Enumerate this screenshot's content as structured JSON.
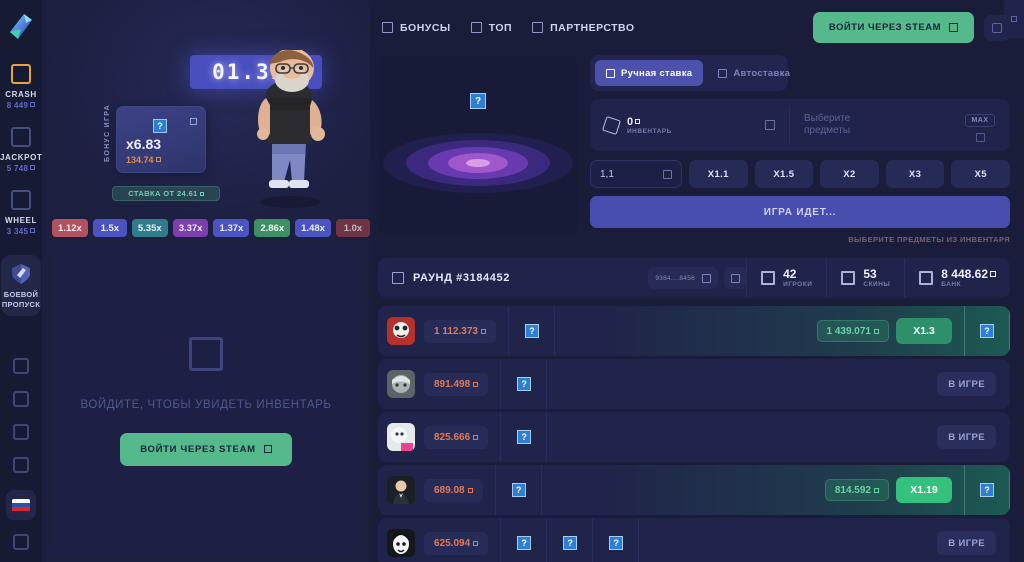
{
  "brand": {
    "logo_icon": "logo-arrow-icon",
    "accent_green": "#55b98c",
    "accent_purple": "#474ead"
  },
  "sidebar": {
    "games": [
      {
        "icon": "crash-icon",
        "title": "CRASH",
        "amount": "8 449"
      },
      {
        "icon": "jackpot-icon",
        "title": "JACKPOT",
        "amount": "5 748"
      },
      {
        "icon": "wheel-icon",
        "title": "WHEEL",
        "amount": "3 345"
      }
    ],
    "battle_pass": {
      "icon": "battle-pass-shield-icon",
      "line1": "БОЕВОЙ",
      "line2": "ПРОПУСК"
    },
    "mini_items": [
      "menu-icon-1",
      "menu-icon-2",
      "menu-icon-3",
      "menu-icon-4"
    ],
    "language": {
      "icon": "flag-ru-icon",
      "colors": [
        "#ffffff",
        "#2b50a8",
        "#d8262f"
      ]
    },
    "bottom_item": "settings-icon"
  },
  "game": {
    "counter": "01.31x",
    "bonus_label": "БОНУС ИГРА",
    "bonus_card": {
      "multiplier": "x6.83",
      "amount": "134.74",
      "item_icon": "crate-item-icon"
    },
    "bet_from": "СТАВКА ОТ 24.61",
    "character": "gaben-character",
    "history": [
      {
        "value": "1.12x",
        "color": "#b2525e"
      },
      {
        "value": "1.5x",
        "color": "#4a53c0"
      },
      {
        "value": "5.35x",
        "color": "#2f7d8b"
      },
      {
        "value": "3.37x",
        "color": "#7b3fad"
      },
      {
        "value": "1.37x",
        "color": "#4a53c0"
      },
      {
        "value": "2.86x",
        "color": "#3d8f66"
      },
      {
        "value": "1.48x",
        "color": "#4a53c0"
      },
      {
        "value": "1.0x",
        "color": "#8c3a44"
      }
    ]
  },
  "inventory": {
    "empty_icon": "empty-box-icon",
    "empty_text": "ВОЙДИТЕ, ЧТОБЫ УВИДЕТЬ ИНВЕНТАРЬ",
    "login_button": "ВОЙТИ ЧЕРЕЗ STEAM"
  },
  "header": {
    "nav": [
      {
        "icon": "gift-icon",
        "label": "БОНУСЫ"
      },
      {
        "icon": "trophy-icon",
        "label": "ТОП"
      },
      {
        "icon": "handshake-icon",
        "label": "ПАРТНЕРСТВО"
      }
    ],
    "login_button": "ВОЙТИ ЧЕРЕЗ STEAM",
    "right_icon": "sound-icon",
    "edge_icon": "chat-toggle-icon"
  },
  "bet_panel": {
    "tabs": [
      {
        "icon": "hand-icon",
        "label": "Ручная ставка",
        "active": true
      },
      {
        "icon": "robot-icon",
        "label": "Автоставка",
        "active": false
      }
    ],
    "inventory_count": "0",
    "inventory_caption": "ИНВЕНТАРЬ",
    "select_items_placeholder": "Выберите\nпредметы",
    "max_label": "MAX",
    "amount_value": "1,1",
    "multipliers": [
      "X1.1",
      "X1.5",
      "X2",
      "X3",
      "X5"
    ],
    "play_button": "ИГРА ИДЕТ...",
    "hint": "ВЫБЕРИТЕ ПРЕДМЕТЫ ИЗ ИНВЕНТАРЯ"
  },
  "round": {
    "icon": "hash-icon",
    "title": "РАУНД #3184452",
    "hash": "9384....8456",
    "stats": [
      {
        "icon": "players-icon",
        "value": "42",
        "caption": "ИГРОКИ"
      },
      {
        "icon": "skins-icon",
        "value": "53",
        "caption": "СКИНЫ"
      },
      {
        "icon": "bank-icon",
        "value": "8 448.62",
        "caption": "БАНК"
      }
    ]
  },
  "players": [
    {
      "avatar": "avatar-panda",
      "avatar_colors": [
        "#c0392b",
        "#ecf0f1"
      ],
      "bet": "1 112.373",
      "items": 1,
      "status": "won",
      "win": "1 439.071",
      "multiplier": "X1.3",
      "tag_style": "dark"
    },
    {
      "avatar": "avatar-gray",
      "avatar_colors": [
        "#95a5a6",
        "#7f8c8d"
      ],
      "bet": "891.498",
      "items": 1,
      "status": "playing",
      "status_label": "В ИГРЕ"
    },
    {
      "avatar": "avatar-pink",
      "avatar_colors": [
        "#ecf0f1",
        "#e84393"
      ],
      "bet": "825.666",
      "items": 1,
      "status": "playing",
      "status_label": "В ИГРЕ"
    },
    {
      "avatar": "avatar-suit",
      "avatar_colors": [
        "#2c3e50",
        "#bdc3c7"
      ],
      "bet": "689.08",
      "items": 1,
      "status": "won",
      "win": "814.592",
      "multiplier": "X1.19",
      "tag_style": "bright"
    },
    {
      "avatar": "avatar-dark",
      "avatar_colors": [
        "#2d3436",
        "#dfe6e9"
      ],
      "bet": "625.094",
      "items": 3,
      "status": "playing",
      "status_label": "В ИГРЕ"
    }
  ]
}
